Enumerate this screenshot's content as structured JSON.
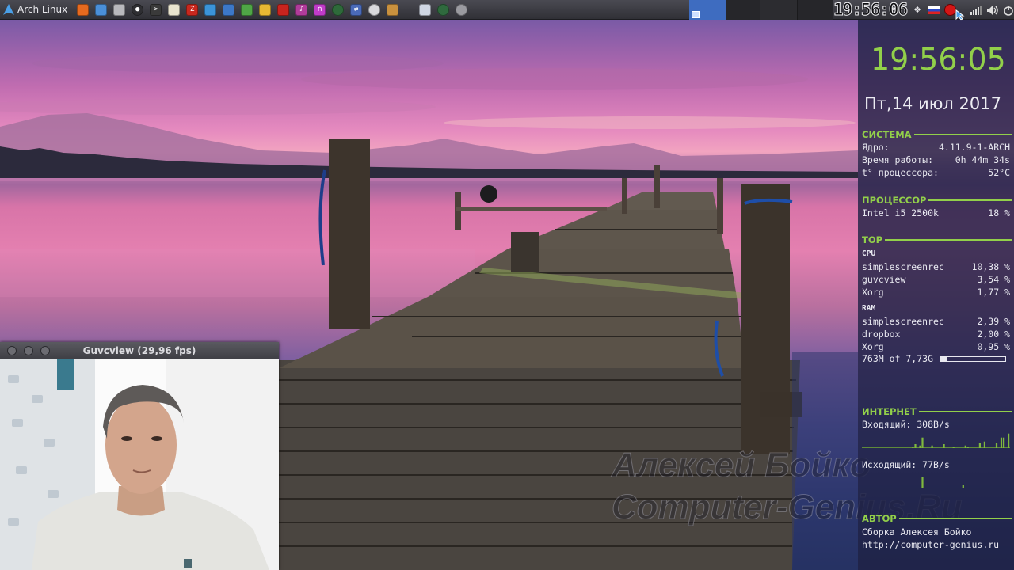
{
  "panel": {
    "menu_label": "Arch Linux",
    "menu_icon": "arch-logo-icon",
    "launchers": [
      {
        "name": "firefox-icon",
        "color": "#e66a1f",
        "glyph": ""
      },
      {
        "name": "chromium-icon",
        "color": "#4a8fd8",
        "glyph": ""
      },
      {
        "name": "file-manager-icon",
        "color": "#b8b8bc",
        "glyph": ""
      },
      {
        "name": "camera-icon",
        "color": "#2e2e32",
        "glyph": "●"
      },
      {
        "name": "terminal-icon",
        "color": "#3a3a3a",
        "glyph": ">"
      },
      {
        "name": "text-editor-icon",
        "color": "#e9e4cf",
        "glyph": ""
      },
      {
        "name": "filezilla-icon",
        "color": "#c8281e",
        "glyph": "Z"
      },
      {
        "name": "writer-icon",
        "color": "#3b94d8",
        "glyph": ""
      },
      {
        "name": "document-viewer-icon",
        "color": "#3c78c8",
        "glyph": ""
      },
      {
        "name": "spreadsheet-icon",
        "color": "#4fa646",
        "glyph": ""
      },
      {
        "name": "image-viewer-icon",
        "color": "#e7b833",
        "glyph": ""
      },
      {
        "name": "cherrytree-icon",
        "color": "#c8241e",
        "glyph": ""
      },
      {
        "name": "audio-player-icon",
        "color": "#b03c9a",
        "glyph": "♪"
      },
      {
        "name": "headphones-icon",
        "color": "#c03cc8",
        "glyph": "∩"
      },
      {
        "name": "globe-icon",
        "color": "#2e6a3a",
        "glyph": ""
      },
      {
        "name": "network-icon",
        "color": "#4a6ab8",
        "glyph": "⇄"
      },
      {
        "name": "settings-icon",
        "color": "#d8d8dc",
        "glyph": ""
      },
      {
        "name": "package-icon",
        "color": "#c9913e",
        "glyph": ""
      },
      {
        "name": "window-icon",
        "color": "#cfd6e4",
        "glyph": ""
      },
      {
        "name": "web-browser-icon",
        "color": "#2f6a3e",
        "glyph": ""
      },
      {
        "name": "power-icon",
        "color": "#9a9aa0",
        "glyph": ""
      }
    ],
    "clock": "19:56:06",
    "tray": [
      {
        "name": "dropbox-icon",
        "glyph": "❖"
      },
      {
        "name": "keyboard-layout-ru-flag-icon",
        "glyph": ""
      },
      {
        "name": "record-icon",
        "glyph": ""
      },
      {
        "name": "signal-icon",
        "glyph": ""
      },
      {
        "name": "volume-icon",
        "glyph": "🔊"
      },
      {
        "name": "power-menu-icon",
        "glyph": "⏻"
      }
    ]
  },
  "conky": {
    "time": "19:56:05",
    "date": "Пт,14 июл 2017",
    "system": {
      "title": "СИСТЕМА",
      "kernel_label": "Ядро:",
      "kernel_value": "4.11.9-1-ARCH",
      "uptime_label": "Время работы:",
      "uptime_value": "0h 44m 34s",
      "temp_label": "t° процессора:",
      "temp_value": "52°C"
    },
    "cpu": {
      "title": "ПРОЦЕССОР",
      "model": "Intel i5 2500k",
      "usage": "18 %"
    },
    "top": {
      "title": "TOP",
      "cpu_label": "CPU",
      "cpu_rows": [
        {
          "name": "simplescreenrec",
          "value": "10,38 %"
        },
        {
          "name": "guvcview",
          "value": "3,54 %"
        },
        {
          "name": "Xorg",
          "value": "1,77 %"
        }
      ],
      "ram_label": "RAM",
      "ram_rows": [
        {
          "name": "simplescreenrec",
          "value": "2,39 %"
        },
        {
          "name": "dropbox",
          "value": "2,00 %"
        },
        {
          "name": "Xorg",
          "value": "0,95 %"
        }
      ],
      "mem_text": "763M of 7,73G",
      "mem_fraction": 0.1
    },
    "internet": {
      "title": "ИНТЕРНЕТ",
      "down_label": "Входящий: 308B/s",
      "up_label": "Исходящий: 77B/s",
      "down_graph": [
        0,
        0,
        0,
        0,
        0,
        0,
        0,
        0,
        0,
        0,
        0,
        0,
        0,
        0,
        0,
        0,
        0,
        0,
        0,
        0,
        0,
        1,
        3,
        0,
        2,
        8,
        0,
        0,
        0,
        2,
        0,
        0,
        0,
        0,
        3,
        0,
        0,
        0,
        1,
        0,
        0,
        0,
        0,
        2,
        1,
        0,
        0,
        0,
        0,
        4,
        0,
        5,
        0,
        0,
        0,
        0,
        4,
        0,
        8,
        8,
        0,
        11
      ],
      "up_graph": [
        0,
        0,
        0,
        0,
        0,
        0,
        0,
        0,
        0,
        0,
        0,
        0,
        0,
        0,
        0,
        0,
        0,
        0,
        0,
        0,
        0,
        0,
        0,
        0,
        0,
        9,
        0,
        0,
        0,
        0,
        0,
        0,
        0,
        0,
        0,
        0,
        0,
        0,
        0,
        0,
        0,
        0,
        3,
        0,
        0,
        0,
        0,
        0,
        0,
        0,
        0,
        0,
        0,
        0,
        0,
        0,
        0,
        0,
        0,
        0,
        0,
        0
      ]
    },
    "author": {
      "title": "АВТОР",
      "line1": "Сборка Алексея Бойко",
      "line2": "http://computer-genius.ru"
    }
  },
  "webcam": {
    "title": "Guvcview  (29,96 fps)"
  },
  "watermark": {
    "line1": "Алексей Бойко",
    "line2": "Computer-Genius.Ru"
  }
}
